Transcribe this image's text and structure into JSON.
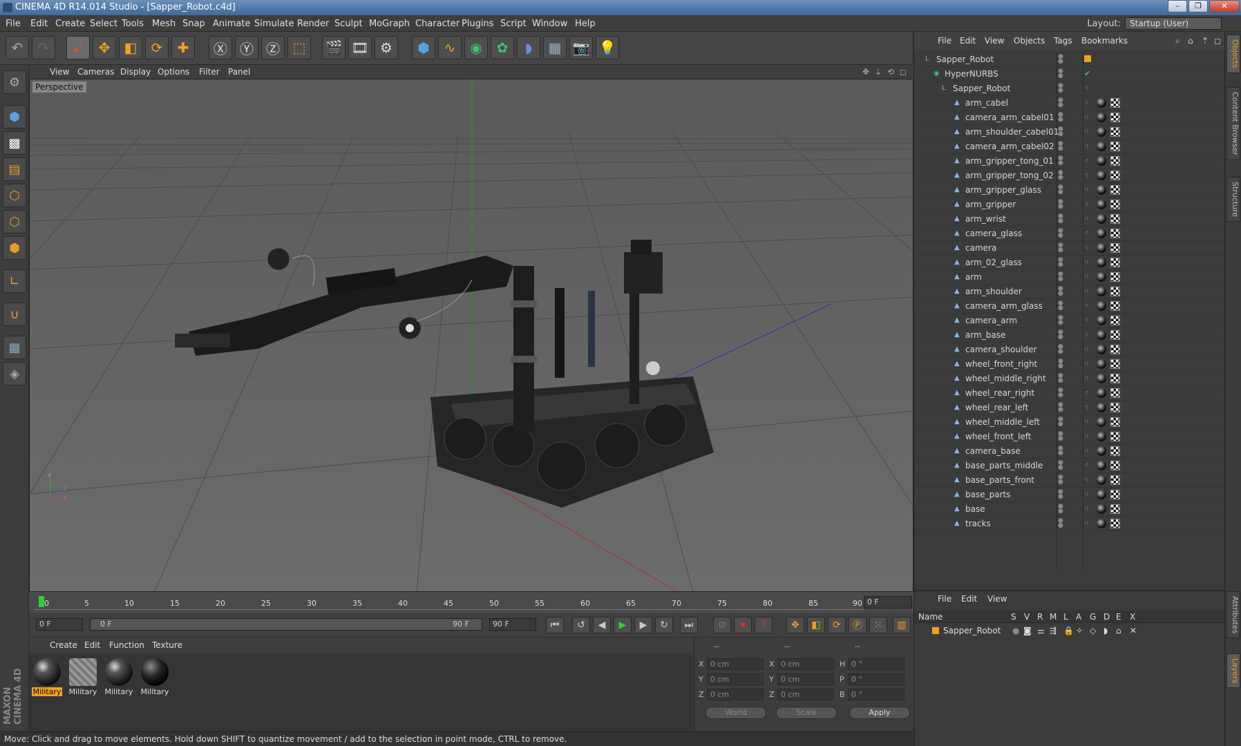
{
  "window": {
    "title": "CINEMA 4D R14.014 Studio - [Sapper_Robot.c4d]"
  },
  "menubar": {
    "items": [
      "File",
      "Edit",
      "Create",
      "Select",
      "Tools",
      "Mesh",
      "Snap",
      "Animate",
      "Simulate",
      "Render",
      "Sculpt",
      "MoGraph",
      "Character",
      "Plugins",
      "Script",
      "Window",
      "Help"
    ],
    "layout_label": "Layout:",
    "layout_value": "Startup (User)"
  },
  "viewport": {
    "menu": [
      "View",
      "Cameras",
      "Display",
      "Options",
      "Filter",
      "Panel"
    ],
    "label": "Perspective",
    "axis_labels": {
      "y": "Y",
      "z": "Z",
      "x": "X"
    }
  },
  "timeline": {
    "ticks": [
      "0",
      "5",
      "10",
      "15",
      "20",
      "25",
      "30",
      "35",
      "40",
      "45",
      "50",
      "55",
      "60",
      "65",
      "70",
      "75",
      "80",
      "85",
      "90"
    ],
    "current_frame": "0 F",
    "start_field": "0 F",
    "range_start": "0 F",
    "range_end": "90 F",
    "end_field": "90 F"
  },
  "materials": {
    "menu": [
      "Create",
      "Edit",
      "Function",
      "Texture"
    ],
    "items": [
      {
        "label": "Military",
        "selected": true
      },
      {
        "label": "Military",
        "selected": false
      },
      {
        "label": "Military",
        "selected": false
      },
      {
        "label": "Military",
        "selected": false
      }
    ]
  },
  "coordinates": {
    "headers": [
      "--",
      "--",
      "--"
    ],
    "rows": [
      {
        "a": "X",
        "a_val": "0 cm",
        "b": "X",
        "b_val": "0 cm",
        "c": "H",
        "c_val": "0 °"
      },
      {
        "a": "Y",
        "a_val": "0 cm",
        "b": "Y",
        "b_val": "0 cm",
        "c": "P",
        "c_val": "0 °"
      },
      {
        "a": "Z",
        "a_val": "0 cm",
        "b": "Z",
        "b_val": "0 cm",
        "c": "B",
        "c_val": "0 °"
      }
    ],
    "world": "World",
    "scale": "Scale",
    "apply": "Apply"
  },
  "status": "Move: Click and drag to move elements. Hold down SHIFT to quantize movement / add to the selection in point mode, CTRL to remove.",
  "object_manager": {
    "menu": [
      "File",
      "Edit",
      "View",
      "Objects",
      "Tags",
      "Bookmarks"
    ],
    "root": "Sapper_Robot",
    "hypernurbs": "HyperNURBS",
    "group": "Sapper_Robot",
    "children": [
      "arm_cabel",
      "camera_arm_cabel01",
      "arm_shoulder_cabel01",
      "camera_arm_cabel02",
      "arm_gripper_tong_01",
      "arm_gripper_tong_02",
      "arm_gripper_glass",
      "arm_gripper",
      "arm_wrist",
      "camera_glass",
      "camera",
      "arm_02_glass",
      "arm",
      "arm_shoulder",
      "camera_arm_glass",
      "camera_arm",
      "arm_base",
      "camera_shoulder",
      "wheel_front_right",
      "wheel_middle_right",
      "wheel_rear_right",
      "wheel_rear_left",
      "wheel_middle_left",
      "wheel_front_left",
      "camera_base",
      "base_parts_middle",
      "base_parts_front",
      "base_parts",
      "base",
      "tracks"
    ]
  },
  "layer_manager": {
    "menu": [
      "File",
      "Edit",
      "View"
    ],
    "columns": [
      "Name",
      "S",
      "V",
      "R",
      "M",
      "L",
      "A",
      "G",
      "D",
      "E",
      "X"
    ],
    "layer": "Sapper_Robot"
  },
  "side_tabs": [
    "Objects",
    "Content Browser",
    "Structure",
    "Attributes",
    "Layers"
  ],
  "brand": "MAXON CINEMA 4D",
  "colors": {
    "accent": "#f0a020",
    "title_bar": "#3e6a9e"
  }
}
